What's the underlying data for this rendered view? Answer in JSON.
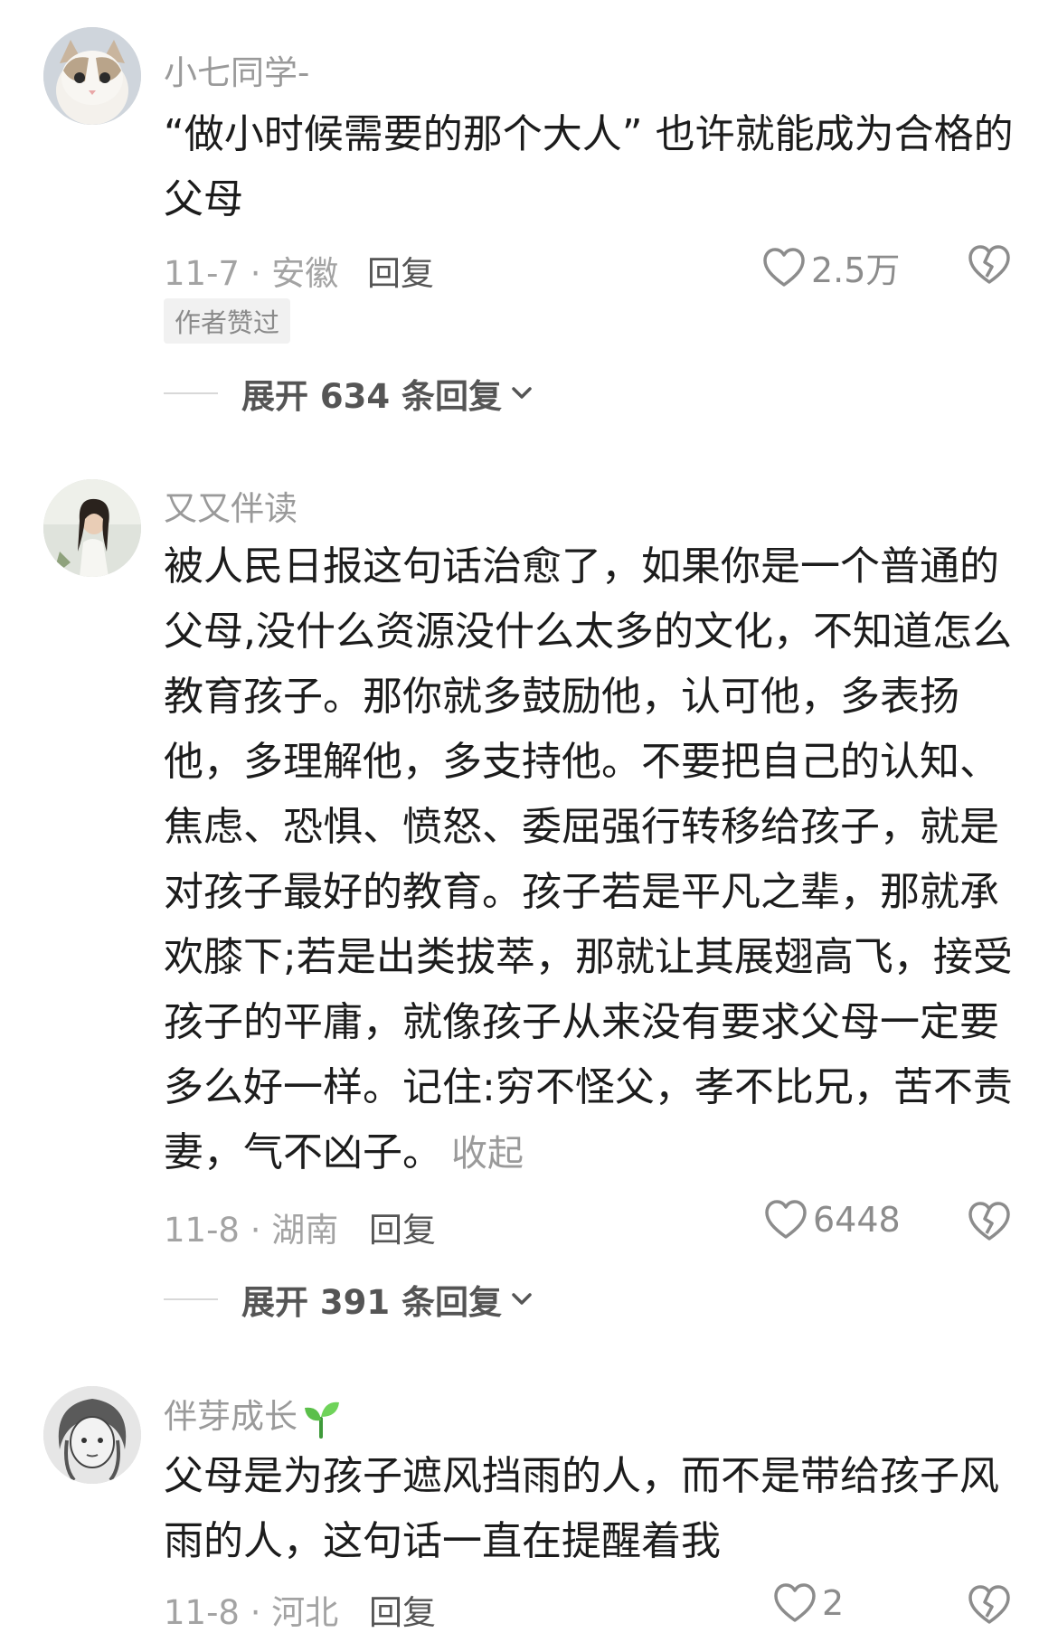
{
  "comments": [
    {
      "username": "小七同学-",
      "text": "“做小时候需要的那个大人” 也许就能成为合格的父母",
      "date_location": "11-7 · 安徽",
      "reply_label": "回复",
      "likes": "2.5万",
      "badge": "作者赞过",
      "expand_label": "展开 634 条回复"
    },
    {
      "username": "又又伴读",
      "text": "被人民日报这句话治愈了，如果你是一个普通的父母,没什么资源没什么太多的文化，不知道怎么教育孩子。那你就多鼓励他，认可他，多表扬他，多理解他，多支持他。不要把自己的认知、焦虑、恐惧、愤怒、委屈强行转移给孩子，就是对孩子最好的教育。孩子若是平凡之辈，那就承欢膝下;若是出类拔萃，那就让其展翅高飞，接受孩子的平庸，就像孩子从来没有要求父母一定要多么好一样。记住:穷不怪父，孝不比兄，苦不责妻，气不凶子。",
      "collapse_label": "收起",
      "date_location": "11-8 · 湖南",
      "reply_label": "回复",
      "likes": "6448",
      "expand_label": "展开 391 条回复"
    },
    {
      "username": "伴芽成长",
      "text": "父母是为孩子遮风挡雨的人，而不是带给孩子风雨的人，这句话一直在提醒着我",
      "date_location": "11-8 · 河北",
      "reply_label": "回复",
      "likes": "2"
    }
  ],
  "icons": {
    "like": "heart-outline-icon",
    "dislike": "broken-heart-icon",
    "expand": "chevron-down-icon",
    "username_emoji": "seedling-icon"
  }
}
